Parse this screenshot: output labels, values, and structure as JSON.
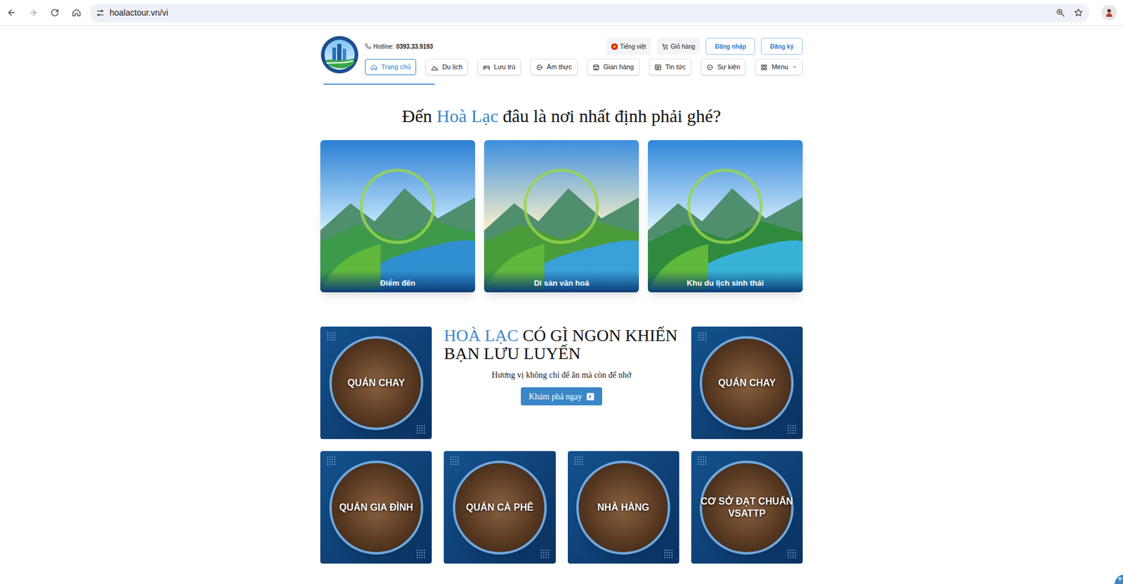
{
  "browser": {
    "url": "hoalactour.vn/vi"
  },
  "header": {
    "hotline_label": "Hotline:",
    "hotline_number": "0393.33.9193",
    "actions": [
      {
        "label": "Tiếng việt",
        "kind": "language"
      },
      {
        "label": "Giỏ hàng",
        "kind": "cart"
      },
      {
        "label": "Đăng nhập",
        "kind": "account"
      },
      {
        "label": "Đăng ký",
        "kind": "account"
      }
    ]
  },
  "nav": [
    {
      "label": "Trang chủ",
      "selected": true,
      "kind": "link"
    },
    {
      "label": "Du lịch",
      "selected": false,
      "kind": "link"
    },
    {
      "label": "Lưu trú",
      "selected": false,
      "kind": "link"
    },
    {
      "label": "Ẩm thực",
      "selected": false,
      "kind": "link"
    },
    {
      "label": "Gian hàng",
      "selected": false,
      "kind": "link"
    },
    {
      "label": "Tin tức",
      "selected": false,
      "kind": "link"
    },
    {
      "label": "Sự kiện",
      "selected": false,
      "kind": "link"
    },
    {
      "label": "Menu",
      "selected": false,
      "kind": "dropdown"
    }
  ],
  "destinations": {
    "title_start": "Đến ",
    "title_highlight": "Hoà Lạc",
    "title_end": " đâu là nơi nhất định phải ghé?",
    "cards": [
      {
        "label": "Điểm đến"
      },
      {
        "label": "Di sản văn hoá"
      },
      {
        "label": "Khu du lịch sinh thái"
      }
    ]
  },
  "food": {
    "title_highlight": "HOÀ LẠC",
    "title_rest": " CÓ GÌ NGON KHIẾN BẠN LƯU LUYẾN",
    "subtitle": "Hương vị không chỉ để ăn mà còn để nhớ",
    "button": "Khám phá ngay",
    "categories": [
      {
        "label": "QUÁN CHAY"
      },
      {
        "label": "QUÁN CHAY"
      },
      {
        "label": "QUÁN GIA ĐÌNH"
      },
      {
        "label": "QUÁN CÀ PHÊ"
      },
      {
        "label": "NHÀ HÀNG"
      },
      {
        "label": "CƠ SỞ ĐẠT CHUẨN VSATTP"
      }
    ]
  }
}
